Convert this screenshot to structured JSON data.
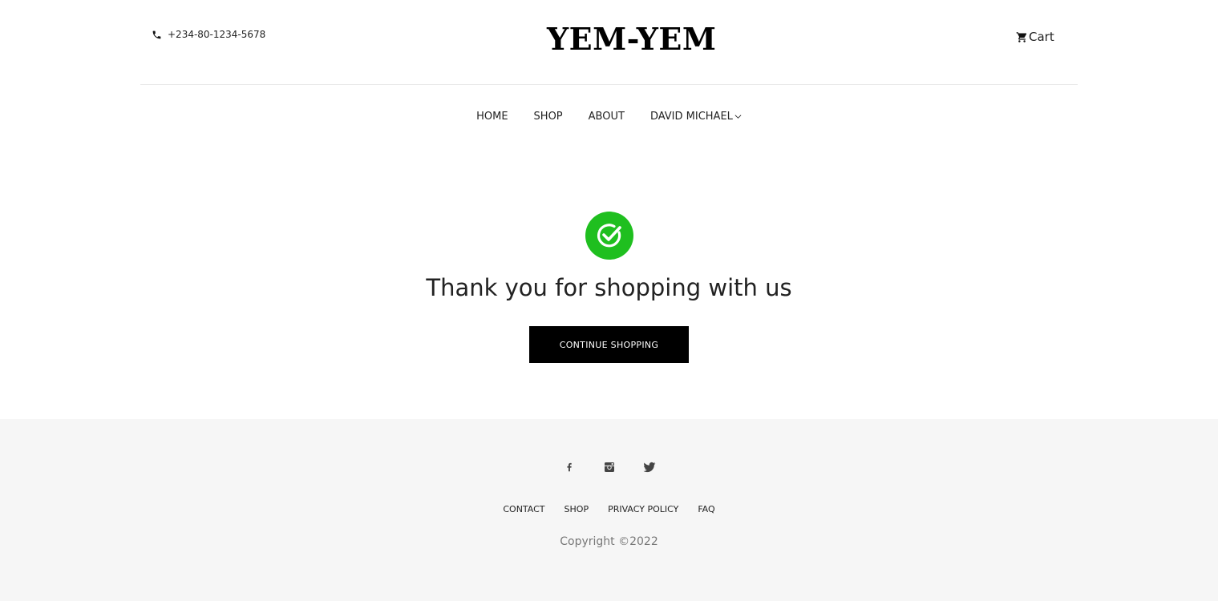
{
  "header": {
    "phone": "+234-80-1234-5678",
    "logo": "YEM-YEM",
    "cart_label": "Cart"
  },
  "nav": {
    "items": [
      "HOME",
      "SHOP",
      "ABOUT"
    ],
    "user_menu": "DAVID MICHAEL"
  },
  "main": {
    "message": "Thank you for shopping with us",
    "button_label": "CONTINUE SHOPPING"
  },
  "footer": {
    "social": [
      "facebook-icon",
      "instagram-icon",
      "twitter-icon"
    ],
    "links": [
      "CONTACT",
      "SHOP",
      "PRIVACY POLICY",
      "FAQ"
    ],
    "copyright": "Copyright ©2022"
  },
  "colors": {
    "success": "#1fbf1f",
    "button_bg": "#000000",
    "footer_bg": "#f6f6f6"
  }
}
